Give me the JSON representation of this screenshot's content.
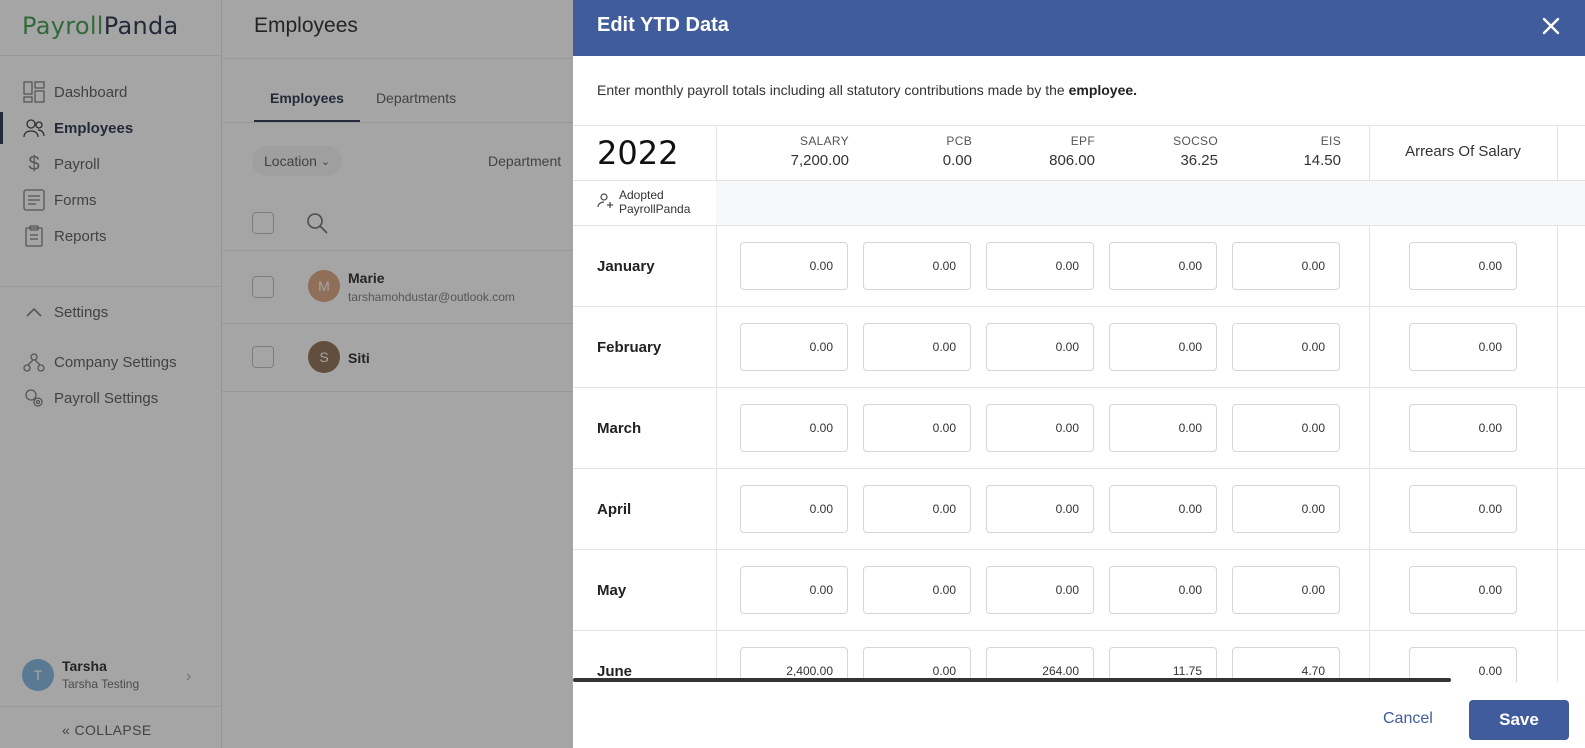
{
  "app": {
    "logo_part1": "Payroll",
    "logo_part2": "Panda",
    "page_title": "Employees",
    "nav": [
      {
        "label": "Dashboard",
        "icon": "dashboard-icon"
      },
      {
        "label": "Employees",
        "icon": "users-icon"
      },
      {
        "label": "Payroll",
        "icon": "dollar-icon"
      },
      {
        "label": "Forms",
        "icon": "forms-icon"
      },
      {
        "label": "Reports",
        "icon": "reports-icon"
      }
    ],
    "settings_label": "Settings",
    "settings_items": [
      {
        "label": "Company Settings",
        "icon": "company-icon"
      },
      {
        "label": "Payroll Settings",
        "icon": "payroll-settings-icon"
      }
    ],
    "user": {
      "initial": "T",
      "name": "Tarsha",
      "company": "Tarsha Testing"
    },
    "collapse_label": "COLLAPSE",
    "tabs": [
      "Employees",
      "Departments"
    ],
    "filters": {
      "location": "Location",
      "department": "Department"
    },
    "employees": [
      {
        "initial": "M",
        "name": "Marie",
        "email": "tarshamohdustar@outlook.com",
        "color": "#d9a27a"
      },
      {
        "initial": "S",
        "name": "Siti",
        "email": "",
        "color": "#8a6a4a"
      }
    ]
  },
  "modal": {
    "title": "Edit YTD Data",
    "intro_text": "Enter monthly payroll totals including all statutory contributions made by the ",
    "intro_bold": "employee.",
    "year": "2022",
    "summary": [
      {
        "label": "SALARY",
        "value": "7,200.00"
      },
      {
        "label": "PCB",
        "value": "0.00"
      },
      {
        "label": "EPF",
        "value": "806.00"
      },
      {
        "label": "SOCSO",
        "value": "36.25"
      },
      {
        "label": "EIS",
        "value": "14.50"
      }
    ],
    "arrears_label": "Arrears Of Salary",
    "adopted_line1": "Adopted",
    "adopted_line2": "PayrollPanda",
    "months": [
      {
        "name": "January",
        "values": [
          "0.00",
          "0.00",
          "0.00",
          "0.00",
          "0.00"
        ],
        "arrears": "0.00"
      },
      {
        "name": "February",
        "values": [
          "0.00",
          "0.00",
          "0.00",
          "0.00",
          "0.00"
        ],
        "arrears": "0.00"
      },
      {
        "name": "March",
        "values": [
          "0.00",
          "0.00",
          "0.00",
          "0.00",
          "0.00"
        ],
        "arrears": "0.00"
      },
      {
        "name": "April",
        "values": [
          "0.00",
          "0.00",
          "0.00",
          "0.00",
          "0.00"
        ],
        "arrears": "0.00"
      },
      {
        "name": "May",
        "values": [
          "0.00",
          "0.00",
          "0.00",
          "0.00",
          "0.00"
        ],
        "arrears": "0.00"
      },
      {
        "name": "June",
        "values": [
          "2,400.00",
          "0.00",
          "264.00",
          "11.75",
          "4.70"
        ],
        "arrears": "0.00"
      }
    ],
    "cancel_label": "Cancel",
    "save_label": "Save",
    "accent_color": "#415c9c"
  }
}
